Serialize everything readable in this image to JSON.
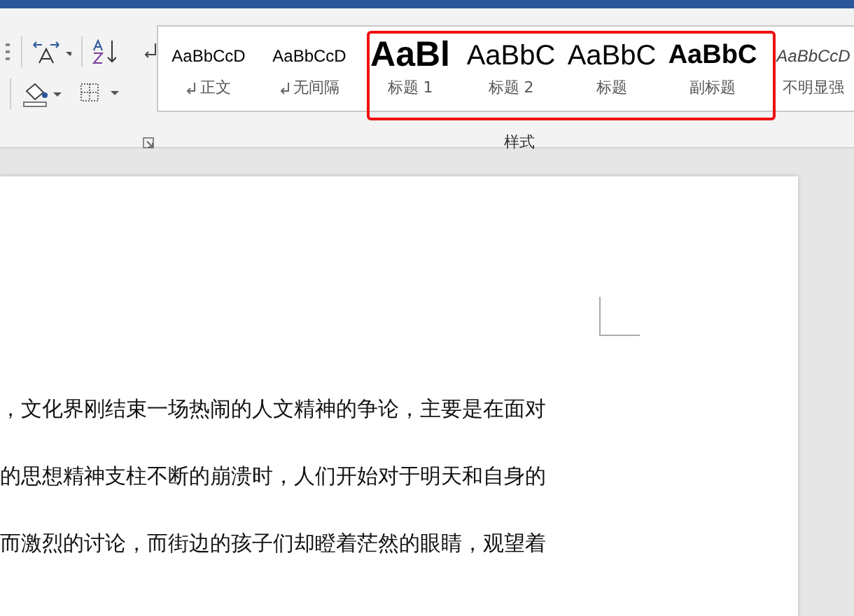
{
  "ribbon": {
    "styles": [
      {
        "preview": "AaBbCcD",
        "name": "正文",
        "paragraph_mark": true,
        "kind": "normal",
        "highlighted": false
      },
      {
        "preview": "AaBbCcD",
        "name": "无间隔",
        "paragraph_mark": true,
        "kind": "normal",
        "highlighted": false
      },
      {
        "preview": "AaBl",
        "name": "标题 1",
        "paragraph_mark": false,
        "kind": "heading1",
        "highlighted": true
      },
      {
        "preview": "AaBbC",
        "name": "标题 2",
        "paragraph_mark": false,
        "kind": "heading2",
        "highlighted": true
      },
      {
        "preview": "AaBbC",
        "name": "标题",
        "paragraph_mark": false,
        "kind": "title",
        "highlighted": true
      },
      {
        "preview": "AaBbC",
        "name": "副标题",
        "paragraph_mark": false,
        "kind": "subtitle",
        "highlighted": true
      },
      {
        "preview": "AaBbCcD",
        "name": "不明显强",
        "paragraph_mark": false,
        "kind": "emphasis",
        "highlighted": false
      }
    ],
    "group_label": "样式"
  },
  "document": {
    "lines": [
      "，文化界刚结束一场热闹的人文精神的争论，主要是在面对",
      "的思想精神支柱不断的崩溃时，人们开始对于明天和自身的",
      "而激烈的讨论，而街边的孩子们却瞪着茫然的眼睛，观望着"
    ]
  }
}
